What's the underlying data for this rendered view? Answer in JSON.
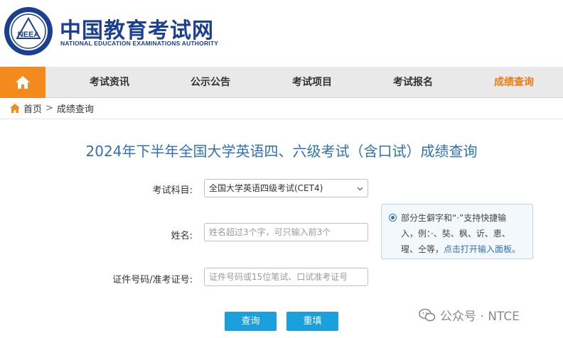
{
  "header": {
    "logo_cn": "中国教育考试网",
    "logo_en": "NATIONAL EDUCATION EXAMINATIONS AUTHORITY",
    "seal_text": "NEEA"
  },
  "nav": {
    "home_icon": "home-icon",
    "items": [
      {
        "label": "考试资讯"
      },
      {
        "label": "公示公告"
      },
      {
        "label": "考试项目"
      },
      {
        "label": "考试报名"
      },
      {
        "label": "成绩查询"
      }
    ],
    "active_color": "#f07a12",
    "home_bg": "#f28a1d"
  },
  "breadcrumb": {
    "home": "首页",
    "separator": ">",
    "current": "成绩查询"
  },
  "page_title": "2024年下半年全国大学英语四、六级考试（含口试）成绩查询",
  "form": {
    "subject_label": "考试科目:",
    "subject_value": "全国大学英语四级考试(CET4)",
    "name_label": "姓名:",
    "name_placeholder": "姓名超过3个字，可只输入前3个",
    "id_label": "证件号码/准考证号:",
    "id_placeholder": "证件号码或15位笔试、口试准考证号"
  },
  "tip": {
    "line1": "部分生僻字和“·”支持快捷输",
    "line2": "入，例：·、奘、枫、䜣、恵、",
    "line3_prefix": "瑆、仝等，",
    "line3_link": "点击打开输入面板。"
  },
  "buttons": {
    "query": "查询",
    "reset": "重填"
  },
  "watermark": {
    "text": "公众号 · NTCE"
  },
  "colors": {
    "title": "#2e72b5",
    "button": "#1aa0dd",
    "brand": "#1b3f91"
  }
}
